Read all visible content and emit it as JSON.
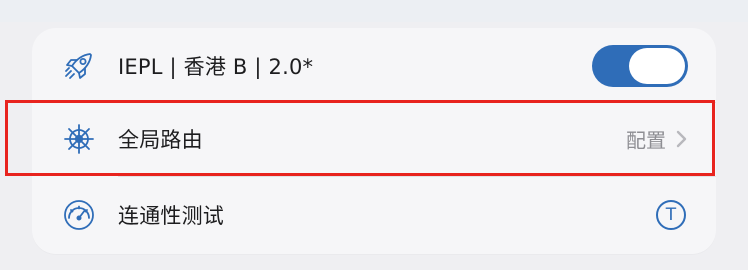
{
  "rows": [
    {
      "icon": "rocket-icon",
      "label": "IEPL  | 香港 B | 2.0*",
      "control": "toggle",
      "toggle_on": true
    },
    {
      "icon": "ship-wheel-icon",
      "label": "全局路由",
      "right_text": "配置",
      "control": "chevron"
    },
    {
      "icon": "speedometer-icon",
      "label": "连通性测试",
      "control": "t-button",
      "button_text": "T"
    }
  ],
  "colors": {
    "accent": "#2f6db8",
    "highlight": "#e8231e",
    "card_bg": "#f6f6f8",
    "page_bg": "#efeff2",
    "text": "#1d1d1f",
    "secondary_text": "#8e8e93"
  }
}
